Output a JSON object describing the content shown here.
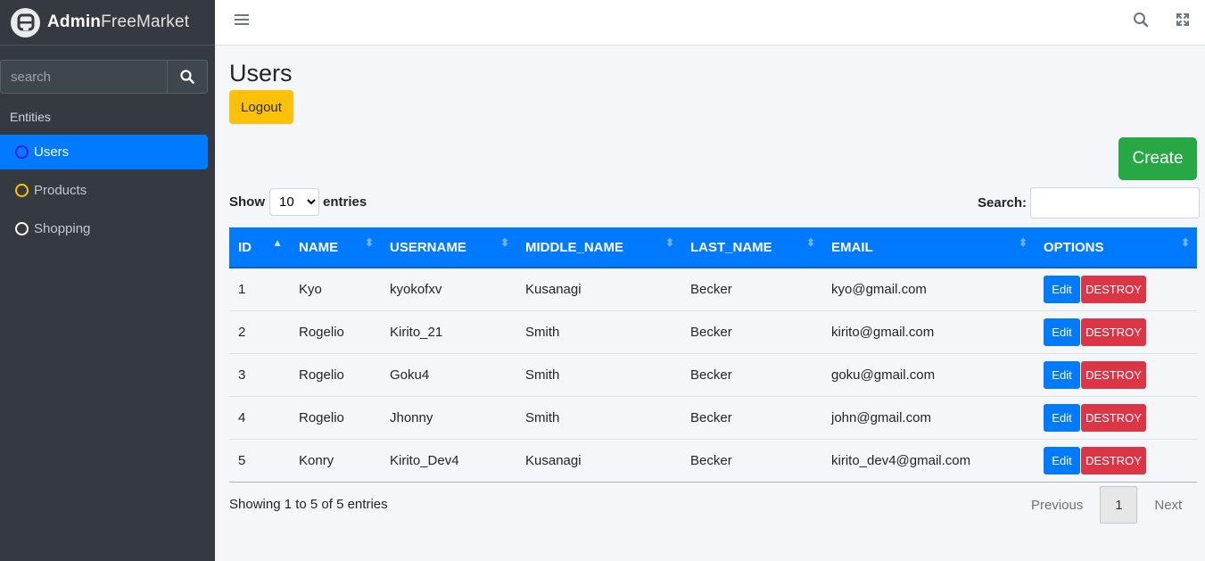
{
  "brand": {
    "bold": "Admin",
    "light": "FreeMarket"
  },
  "sidebar": {
    "search_placeholder": "search",
    "header": "Entities",
    "items": [
      {
        "label": "Users",
        "active": true,
        "circle_color": "#3f1fd6"
      },
      {
        "label": "Products",
        "active": false,
        "circle_color": "#ffc107"
      },
      {
        "label": "Shopping",
        "active": false,
        "circle_color": "#ffffff"
      }
    ]
  },
  "page": {
    "title": "Users",
    "logout_label": "Logout",
    "create_label": "Create"
  },
  "table_controls": {
    "show_label": "Show",
    "entries_label": "entries",
    "length_value": "10",
    "search_label": "Search:"
  },
  "table": {
    "columns": [
      "ID",
      "NAME",
      "USERNAME",
      "MIDDLE_NAME",
      "LAST_NAME",
      "EMAIL",
      "OPTIONS"
    ],
    "rows": [
      {
        "id": "1",
        "name": "Kyo",
        "username": "kyokofxv",
        "middle_name": "Kusanagi",
        "last_name": "Becker",
        "email": "kyo@gmail.com"
      },
      {
        "id": "2",
        "name": "Rogelio",
        "username": "Kirito_21",
        "middle_name": "Smith",
        "last_name": "Becker",
        "email": "kirito@gmail.com"
      },
      {
        "id": "3",
        "name": "Rogelio",
        "username": "Goku4",
        "middle_name": "Smith",
        "last_name": "Becker",
        "email": "goku@gmail.com"
      },
      {
        "id": "4",
        "name": "Rogelio",
        "username": "Jhonny",
        "middle_name": "Smith",
        "last_name": "Becker",
        "email": "john@gmail.com"
      },
      {
        "id": "5",
        "name": "Konry",
        "username": "Kirito_Dev4",
        "middle_name": "Kusanagi",
        "last_name": "Becker",
        "email": "kirito_dev4@gmail.com"
      }
    ],
    "edit_label": "Edit",
    "destroy_label": "DESTROY"
  },
  "footer": {
    "info": "Showing 1 to 5 of 5 entries",
    "previous": "Previous",
    "current_page": "1",
    "next": "Next"
  },
  "colors": {
    "sidebar_bg": "#343a40",
    "accent": "#007bff",
    "warning": "#ffc107",
    "success": "#28a745",
    "danger": "#dc3545"
  }
}
